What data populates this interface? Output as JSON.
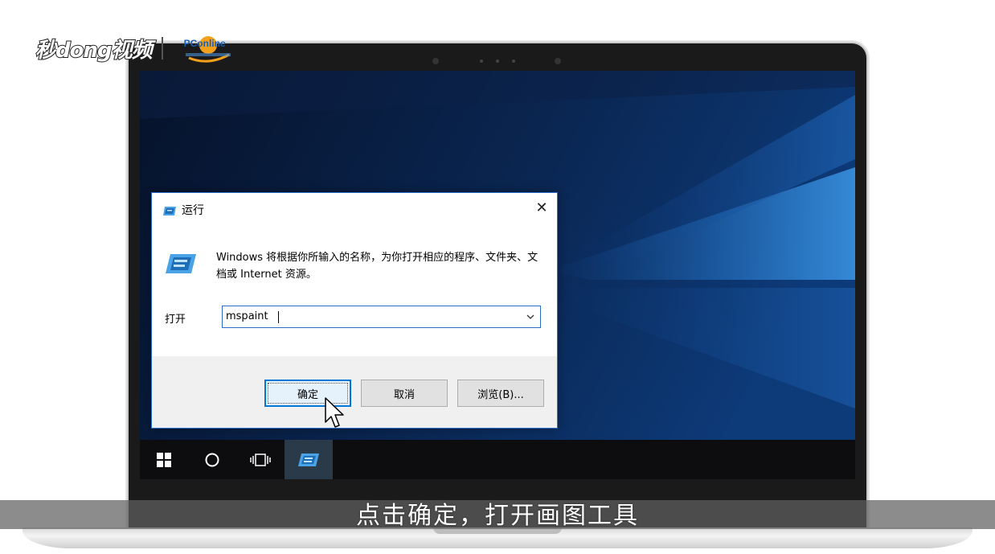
{
  "watermark": {
    "brand": "秒dong视频",
    "partner": "PConline"
  },
  "run_dialog": {
    "title": "运行",
    "close_glyph": "✕",
    "description": "Windows 将根据你所输入的名称，为你打开相应的程序、文件夹、文档或 Internet 资源。",
    "open_label": "打开",
    "open_value": "mspaint",
    "buttons": {
      "ok": "确定",
      "cancel": "取消",
      "browse": "浏览(B)..."
    },
    "icon": "run-dialog-icon"
  },
  "taskbar": {
    "items": [
      {
        "name": "start-button",
        "icon": "windows-logo-icon"
      },
      {
        "name": "cortana-button",
        "icon": "circle-icon"
      },
      {
        "name": "task-view-button",
        "icon": "task-view-icon"
      },
      {
        "name": "run-app-button",
        "icon": "run-dialog-icon",
        "active": true
      }
    ]
  },
  "caption": "点击确定，打开画图工具",
  "colors": {
    "accent": "#0078d7",
    "wallpaper_dark": "#08142b",
    "wallpaper_light": "#2f7fd0",
    "taskbar": "#0d0d10",
    "caption_bg": "#5f5f5f"
  }
}
